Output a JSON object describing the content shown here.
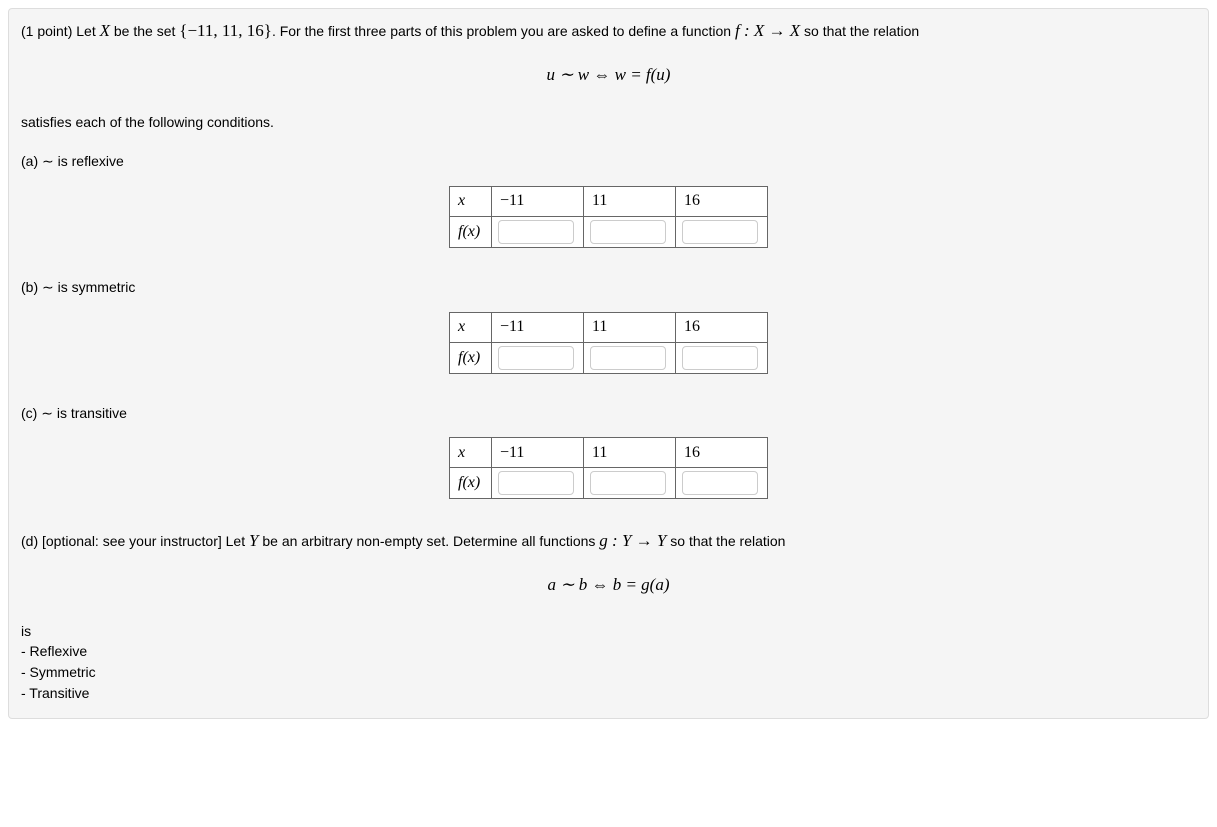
{
  "intro": {
    "points_prefix": "(1 point) Let ",
    "X": "X",
    "be_the_set": " be the set ",
    "set_literal": "{−11, 11, 16}",
    "after_set": ". For the first three parts of this problem you are asked to define a function ",
    "f_decl": "f : X → X",
    "so_that": " so that the relation"
  },
  "eq1": "u ∼ w ⇔ w = f(u)",
  "satisfies": "satisfies each of the following conditions.",
  "parts": {
    "a": {
      "label": "(a) ∼ is reflexive"
    },
    "b": {
      "label": "(b) ∼ is symmetric"
    },
    "c": {
      "label": "(c) ∼ is transitive"
    }
  },
  "table": {
    "x_label": "x",
    "fx_label": "f(x)",
    "cols": [
      "−11",
      "11",
      "16"
    ]
  },
  "partD": {
    "prefix": "(d) [optional: see your instructor] Let ",
    "Y": "Y",
    "mid1": " be an arbitrary non-empty set. Determine all functions ",
    "g_decl": "g : Y → Y",
    "mid2": " so that the relation"
  },
  "eq2": "a ∼ b ⇔ b = g(a)",
  "is_text": "is",
  "bullets": [
    "- Reflexive",
    "- Symmetric",
    "- Transitive"
  ]
}
